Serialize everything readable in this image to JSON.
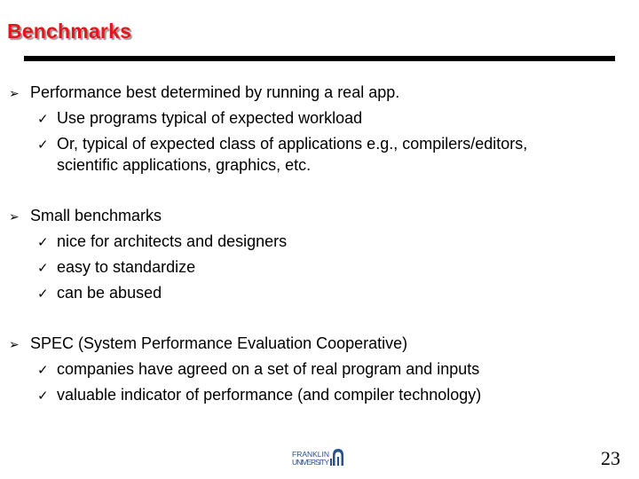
{
  "slide": {
    "title": "Benchmarks",
    "page_number": "23",
    "logo": {
      "line1": "FRANKLIN",
      "line2": "UNIVERSITY",
      "color": "#2a4f8f"
    },
    "title_color": "#e8141b"
  },
  "bullets": [
    {
      "text": "Performance best determined by running a real app.",
      "subs": [
        "Use programs typical of expected workload",
        "Or, typical of expected class of applications e.g., compilers/editors,"
      ],
      "continuation": "scientific applications, graphics, etc."
    },
    {
      "text": "Small benchmarks",
      "subs": [
        "nice for architects and designers",
        "easy to standardize",
        "can be abused"
      ]
    },
    {
      "text": "SPEC (System Performance Evaluation Cooperative)",
      "subs": [
        "companies have agreed on a set of real program and inputs",
        "valuable indicator of  performance (and compiler technology)"
      ]
    }
  ],
  "icons": {
    "bullet": "arrow-bullet-icon",
    "sub_bullet": "checkmark-icon"
  }
}
